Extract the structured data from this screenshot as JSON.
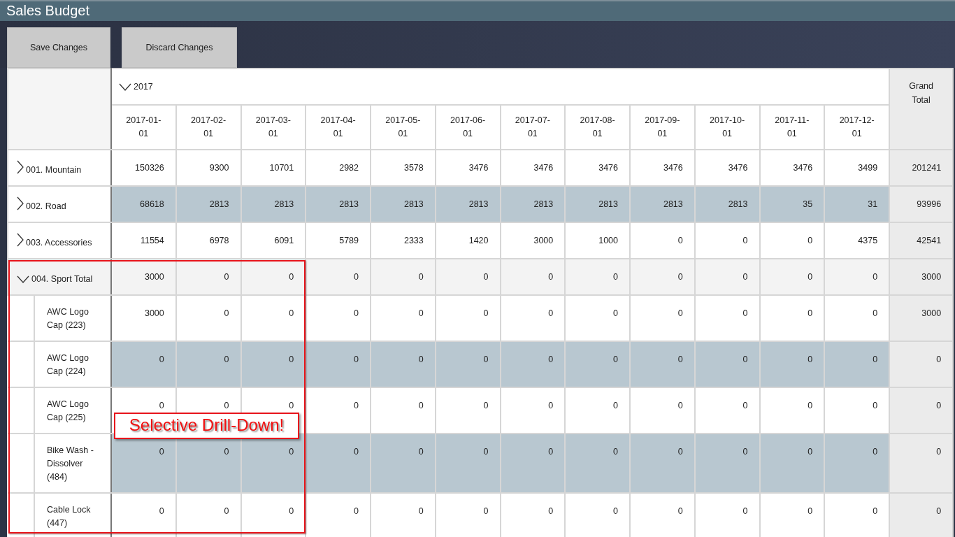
{
  "window": {
    "title": "Sales Budget"
  },
  "toolbar": {
    "buttons": [
      "Save Changes",
      "Discard Changes"
    ]
  },
  "table": {
    "year": {
      "label": "2017",
      "expanded": true
    },
    "months": [
      "2017-01-01",
      "2017-02-01",
      "2017-03-01",
      "2017-04-01",
      "2017-05-01",
      "2017-06-01",
      "2017-07-01",
      "2017-08-01",
      "2017-09-01",
      "2017-10-01",
      "2017-11-01",
      "2017-12-01"
    ],
    "grand_total_label": "Grand Total",
    "rows": [
      {
        "label": "001. Mountain",
        "expanded": false,
        "shaded": false,
        "values": [
          "150326",
          "9300",
          "10701",
          "2982",
          "3578",
          "3476",
          "3476",
          "3476",
          "3476",
          "3476",
          "3476",
          "3499"
        ],
        "total": "201241"
      },
      {
        "label": "002. Road",
        "expanded": false,
        "shaded": true,
        "values": [
          "68618",
          "2813",
          "2813",
          "2813",
          "2813",
          "2813",
          "2813",
          "2813",
          "2813",
          "2813",
          "35",
          "31"
        ],
        "total": "93996"
      },
      {
        "label": "003. Accessories",
        "expanded": false,
        "shaded": false,
        "values": [
          "11554",
          "6978",
          "6091",
          "5789",
          "2333",
          "1420",
          "3000",
          "1000",
          "0",
          "0",
          "0",
          "4375"
        ],
        "total": "42541"
      },
      {
        "label": "004. Sport Total",
        "expanded": true,
        "shaded": false,
        "values": [
          "3000",
          "0",
          "0",
          "0",
          "0",
          "0",
          "0",
          "0",
          "0",
          "0",
          "0",
          "0"
        ],
        "total": "3000",
        "children": [
          {
            "label": "AWC Logo Cap (223)",
            "shaded": false,
            "values": [
              "3000",
              "0",
              "0",
              "0",
              "0",
              "0",
              "0",
              "0",
              "0",
              "0",
              "0",
              "0"
            ],
            "total": "3000"
          },
          {
            "label": "AWC Logo Cap (224)",
            "shaded": true,
            "values": [
              "0",
              "0",
              "0",
              "0",
              "0",
              "0",
              "0",
              "0",
              "0",
              "0",
              "0",
              "0"
            ],
            "total": "0"
          },
          {
            "label": "AWC Logo Cap (225)",
            "shaded": false,
            "values": [
              "0",
              "0",
              "0",
              "0",
              "0",
              "0",
              "0",
              "0",
              "0",
              "0",
              "0",
              "0"
            ],
            "total": "0"
          },
          {
            "label": "Bike Wash - Dissolver (484)",
            "shaded": true,
            "values": [
              "0",
              "0",
              "0",
              "0",
              "0",
              "0",
              "0",
              "0",
              "0",
              "0",
              "0",
              "0"
            ],
            "total": "0"
          },
          {
            "label": "Cable Lock (447)",
            "shaded": false,
            "values": [
              "0",
              "0",
              "0",
              "0",
              "0",
              "0",
              "0",
              "0",
              "0",
              "0",
              "0",
              "0"
            ],
            "total": "0"
          }
        ]
      }
    ]
  },
  "annotations": [
    {
      "kind": "frame"
    },
    {
      "kind": "callout",
      "text": "Selective Drill-Down!"
    }
  ]
}
